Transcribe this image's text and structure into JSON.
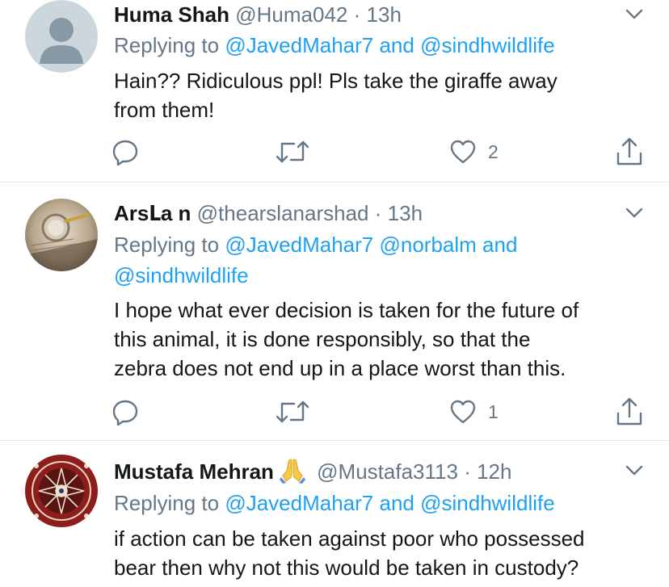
{
  "tweets": [
    {
      "name": "Huma Shah",
      "handle": "@Huma042",
      "dot": "·",
      "time": "13h",
      "replying_prefix": "Replying to",
      "replying_line1": [
        {
          "text": "@JavedMahar7",
          "kind": "mention"
        },
        {
          "text": " and ",
          "kind": "plain-mention"
        },
        {
          "text": "@sindhwildlife",
          "kind": "mention"
        }
      ],
      "body": [
        "Hain?? Ridiculous ppl! Pls take the giraffe away",
        "from them!"
      ],
      "likes": "2",
      "avatar_icon": "default-profile-icon"
    },
    {
      "name": "ArsԼa n",
      "handle": "@thearslanarshad",
      "dot": "·",
      "time": "13h",
      "replying_prefix": "Replying to",
      "replying_line1_text_a": "@JavedMahar7",
      "replying_line1_text_b": "@norbalm",
      "replying_line1_and": " and",
      "replying_line2": "@sindhwildlife",
      "body": [
        "I hope what ever decision is taken for the future of",
        "this animal, it is done responsibly, so that the",
        "zebra does not end up in a place worst than this."
      ],
      "likes": "1",
      "avatar_icon": "magnifier-photo-avatar"
    },
    {
      "name": "Mustafa Mehran",
      "emoji_icon": "folded-hands-icon",
      "handle": "@Mustafa3113",
      "dot": "·",
      "time": "12h",
      "replying_prefix": "Replying to",
      "mention_a": "@JavedMahar7",
      "mention_and": "and",
      "mention_b": "@sindhwildlife",
      "body": [
        "if action can be taken against poor who possessed",
        "bear then why not this would be taken in custody?"
      ],
      "avatar_icon": "carpet-pattern-avatar"
    }
  ],
  "colors": {
    "mention": "#1da1f2",
    "secondary": "#657786",
    "text": "#14171a",
    "divider": "#e1e8ed"
  },
  "icons": [
    "reply-icon",
    "retweet-icon",
    "like-icon",
    "share-icon",
    "chevron-down-icon"
  ]
}
